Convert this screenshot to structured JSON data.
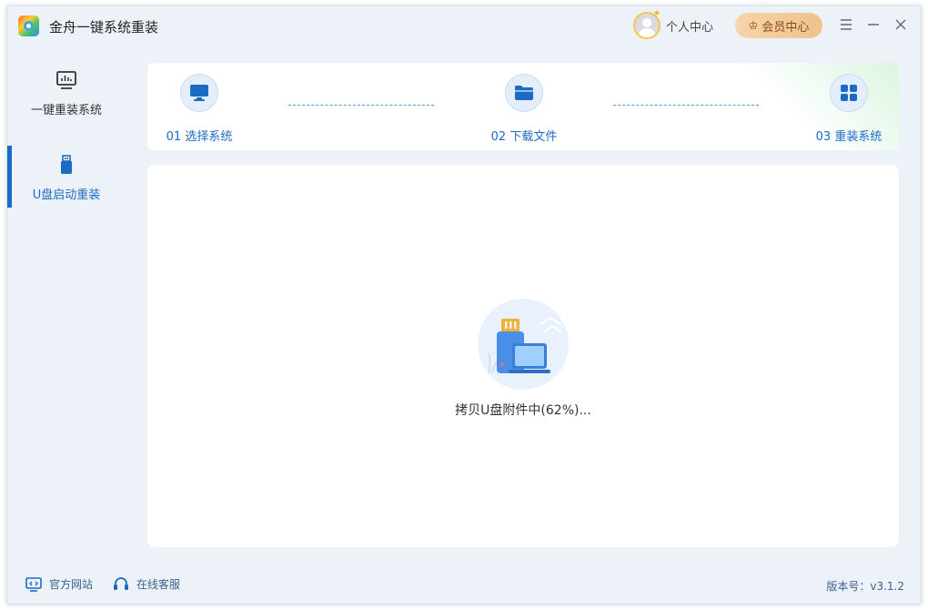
{
  "app": {
    "title": "金舟一键系统重装",
    "user_center_label": "个人中心",
    "vip_label": "会员中心"
  },
  "sidebar": {
    "items": [
      {
        "label": "一键重装系统",
        "icon": "monitor-chart-icon",
        "active": false
      },
      {
        "label": "U盘启动重装",
        "icon": "usb-drive-icon",
        "active": true
      }
    ]
  },
  "steps": [
    {
      "label": "01 选择系统",
      "icon": "monitor-icon"
    },
    {
      "label": "02 下载文件",
      "icon": "folder-icon"
    },
    {
      "label": "03 重装系统",
      "icon": "windows-grid-icon"
    }
  ],
  "main": {
    "status_text": "拷贝U盘附件中(62%)...",
    "progress_percent": 62
  },
  "footer": {
    "site_label": "官方网站",
    "service_label": "在线客服",
    "version_text": "版本号：v3.1.2"
  },
  "colors": {
    "accent": "#1b6bc4",
    "window_bg": "#edf2f8",
    "vip_bg": "#efc28f"
  }
}
